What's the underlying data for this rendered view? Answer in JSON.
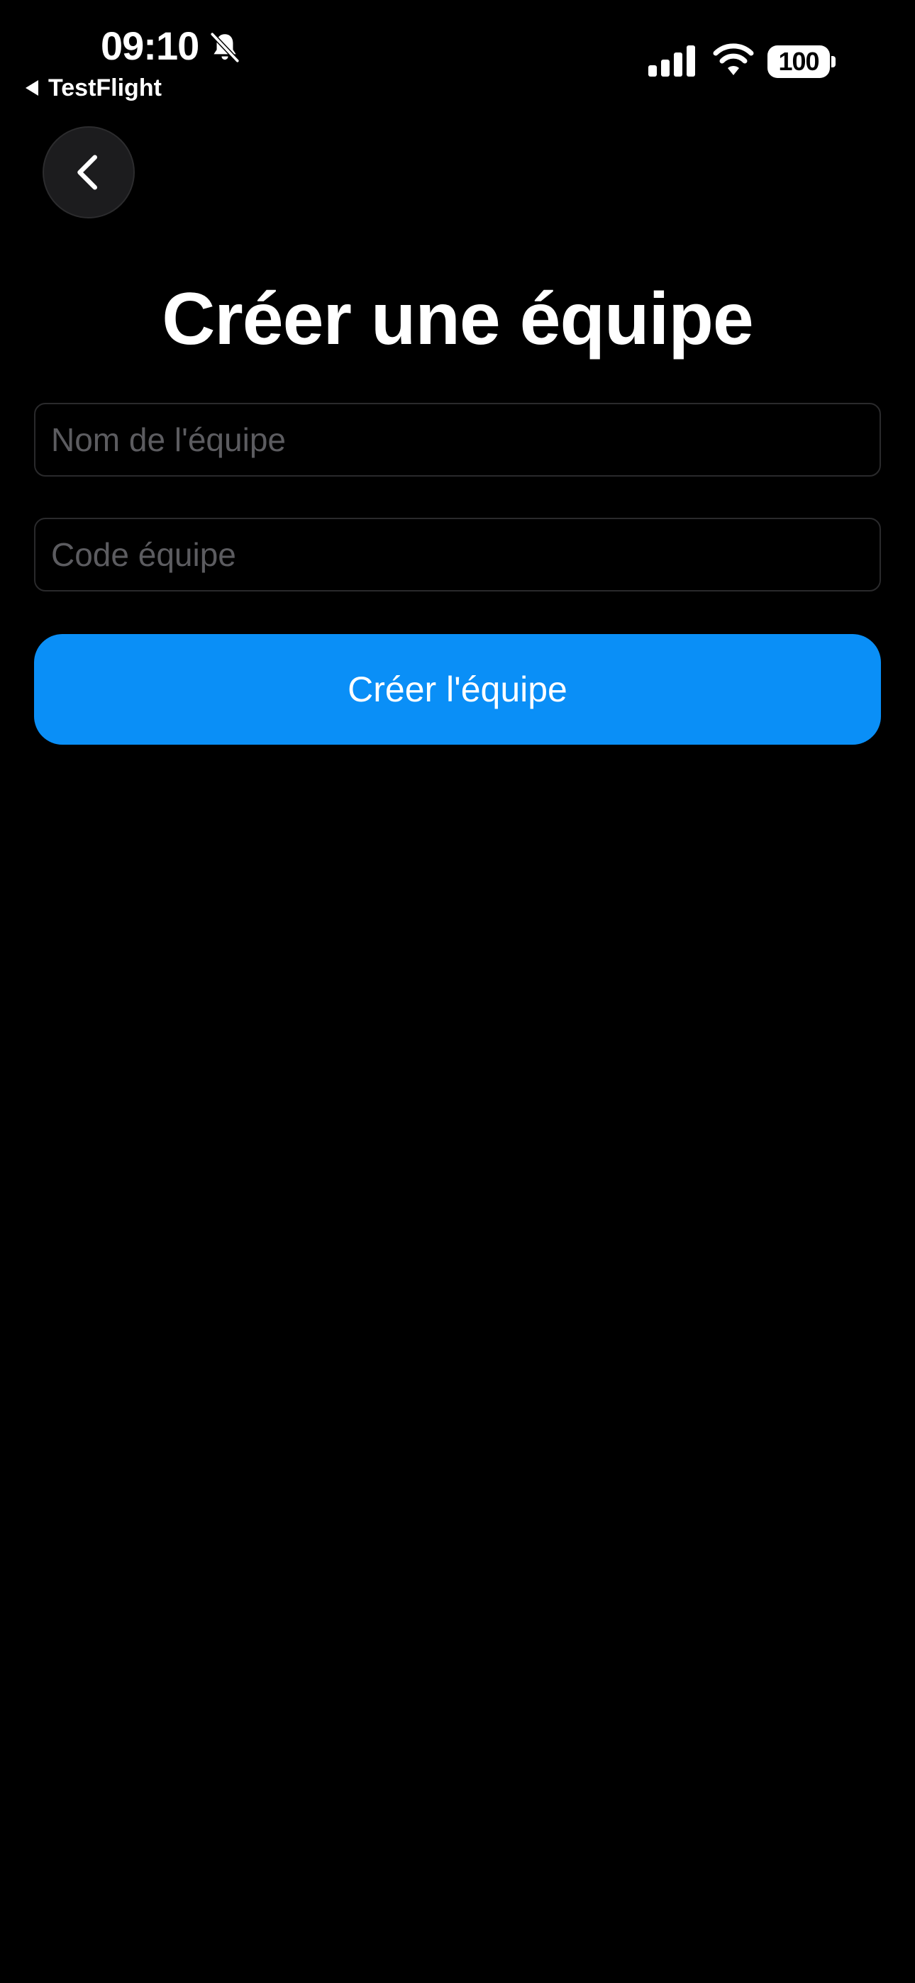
{
  "status_bar": {
    "time": "09:10",
    "back_app_label": "TestFlight",
    "battery_level": "100",
    "icons": [
      "bell-slash-icon",
      "signal-icon",
      "wifi-icon",
      "battery-icon"
    ]
  },
  "nav": {
    "back_icon": "chevron-left-icon"
  },
  "page": {
    "title": "Créer une équipe"
  },
  "form": {
    "team_name": {
      "value": "",
      "placeholder": "Nom de l'équipe"
    },
    "team_code": {
      "value": "",
      "placeholder": "Code équipe"
    },
    "submit_label": "Créer l'équipe"
  },
  "colors": {
    "background": "#000000",
    "accent": "#0a8ff7",
    "placeholder": "#5c5c60",
    "field_border": "#2a2a2c",
    "back_button_bg": "#1c1c1e"
  }
}
